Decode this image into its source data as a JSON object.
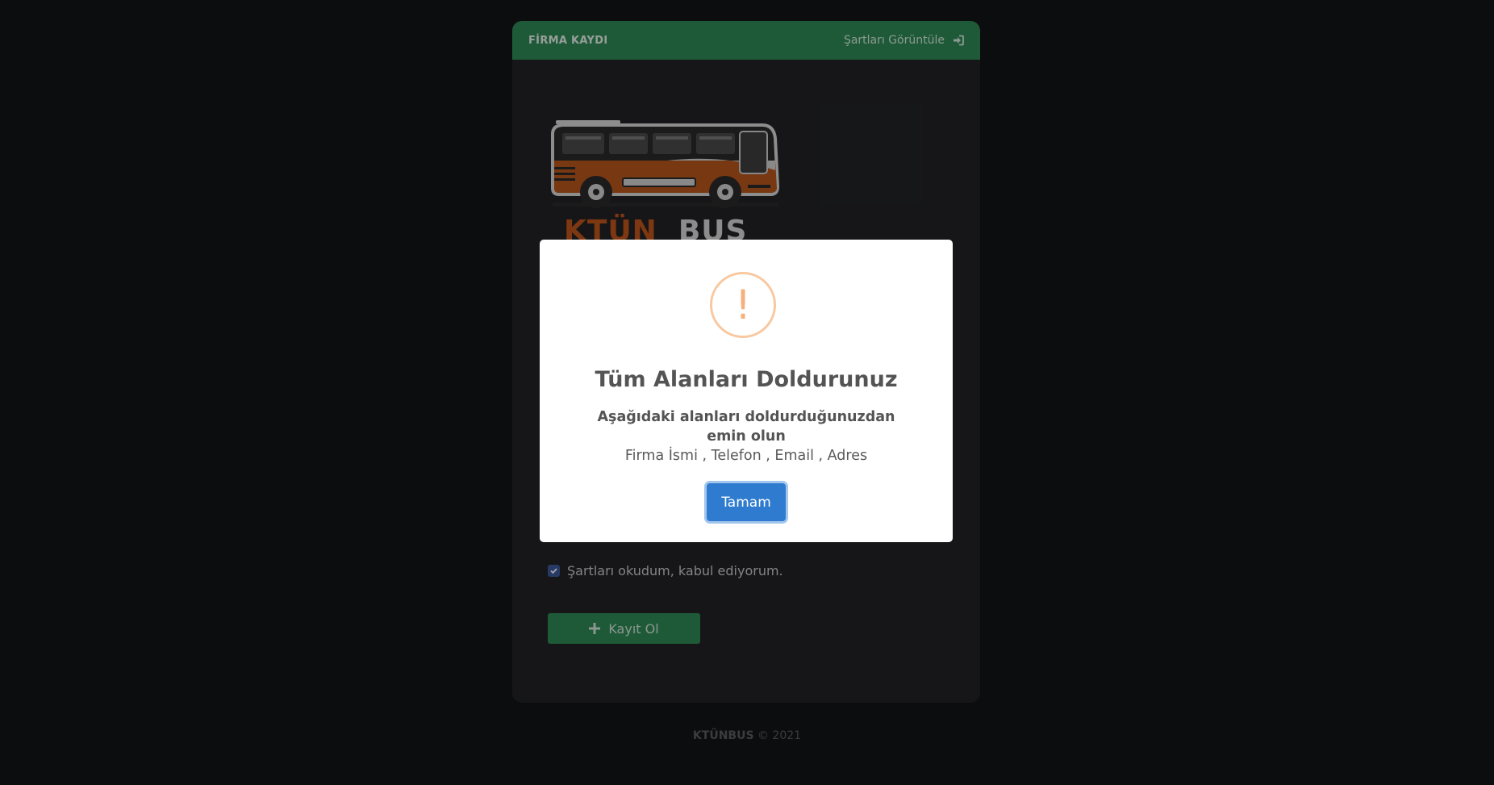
{
  "header": {
    "title": "FİRMA KAYDI",
    "terms_link": "Şartları Görüntüle",
    "terms_icon": "sign-in-icon"
  },
  "logo": {
    "part1": "KTÜN",
    "part2": "BUS",
    "colors": {
      "primary": "#c0571c",
      "secondary": "#d7d7d7"
    }
  },
  "form": {
    "agree_label": "Şartları okudum, kabul ediyorum.",
    "agree_checked": true,
    "register_label": "Kayıt Ol"
  },
  "footer": {
    "brand": "KTÜNBUS",
    "copyright": "© 2021"
  },
  "modal": {
    "title": "Tüm Alanları Doldurunuz",
    "message": "Aşağıdaki alanları doldurduğunuzdan emin olun",
    "fields": "Firma İsmi , Telefon , Email , Adres",
    "ok_label": "Tamam",
    "icon": "warning-icon"
  },
  "colors": {
    "background": "#131417",
    "card": "#222326",
    "accent_green": "#2e8b57",
    "button_blue": "#2e7bcf",
    "warning": "#f5b07d"
  }
}
